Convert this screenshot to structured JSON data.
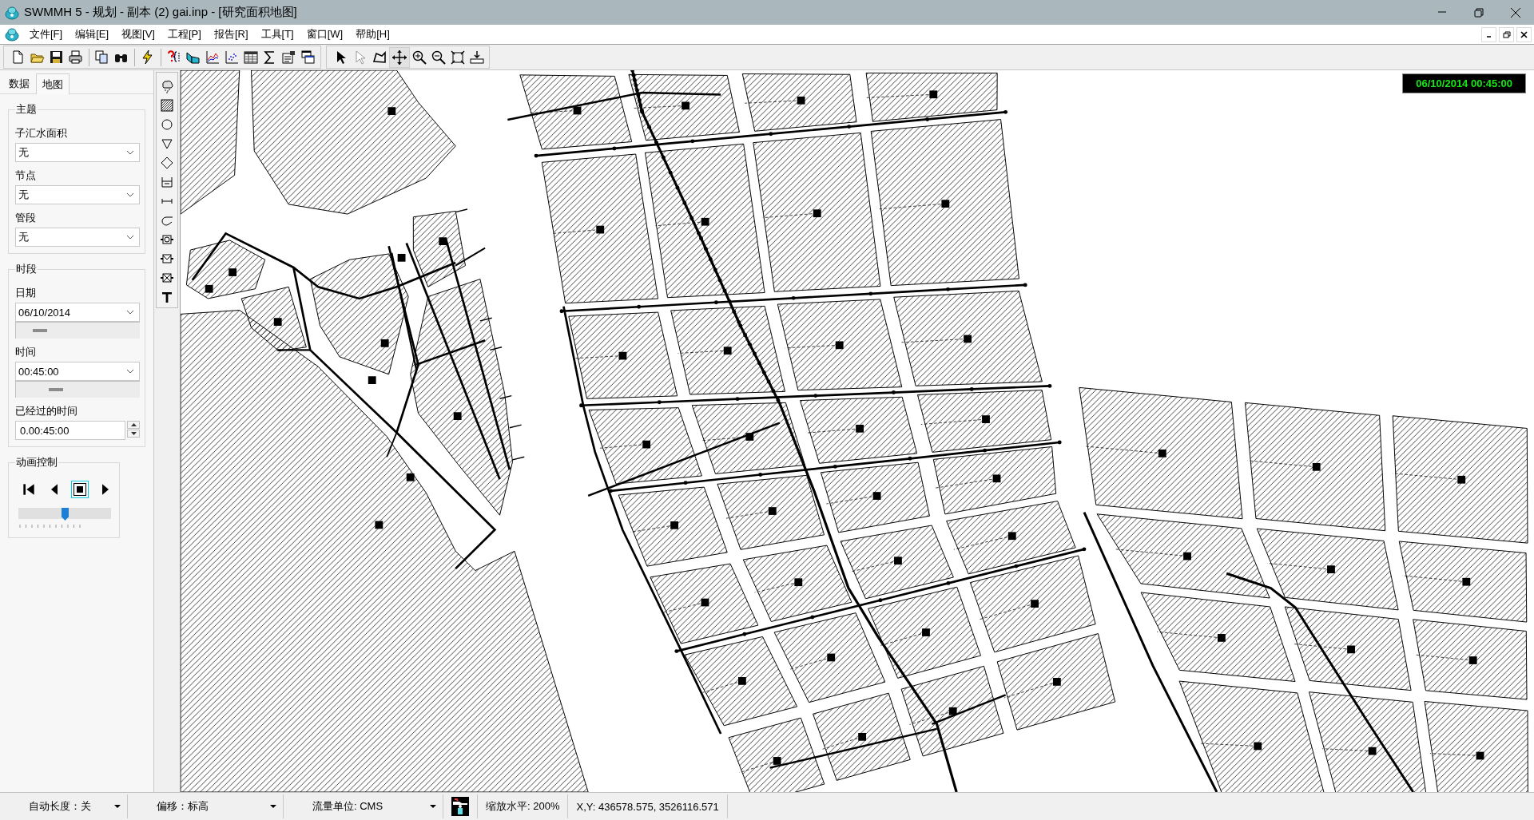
{
  "window": {
    "title": "SWMMH 5 - 规划 - 副本 (2) gai.inp - [研究面积地图]"
  },
  "menu": [
    "文件[F]",
    "编辑[E]",
    "视图[V]",
    "工程[P]",
    "报告[R]",
    "工具[T]",
    "窗口[W]",
    "帮助[H]"
  ],
  "side_panel": {
    "tabs": [
      {
        "label": "数据",
        "selected": false
      },
      {
        "label": "地图",
        "selected": true
      }
    ],
    "theme": {
      "title": "主题",
      "fields": [
        {
          "label": "子汇水面积",
          "value": "无"
        },
        {
          "label": "节点",
          "value": "无"
        },
        {
          "label": "管段",
          "value": "无"
        }
      ]
    },
    "period": {
      "title": "时段",
      "date": {
        "label": "日期",
        "value": "06/10/2014",
        "level": 0.15
      },
      "time": {
        "label": "时间",
        "value": "00:45:00",
        "level": 0.3
      },
      "elapsed": {
        "label": "已经过的时间",
        "value": "0.00:45:00"
      }
    },
    "animation": {
      "title": "动画控制",
      "buttons": [
        {
          "kind": "rewind",
          "selected": false
        },
        {
          "kind": "back",
          "selected": false
        },
        {
          "kind": "stop",
          "selected": true
        },
        {
          "kind": "forward",
          "selected": false
        }
      ],
      "level": 0.5
    }
  },
  "map": {
    "timestamp": "06/10/2014 00:45:00"
  },
  "status_bar": [
    {
      "kind": "dropdown",
      "text": "自动长度：关"
    },
    {
      "kind": "dropdown",
      "text": "偏移：标高"
    },
    {
      "kind": "dropdown",
      "text": "流量单位: CMS"
    },
    {
      "kind": "icon"
    },
    {
      "kind": "text",
      "text": "缩放水平: 200%"
    },
    {
      "kind": "text",
      "text": "X,Y: 436578.575, 3526116.571"
    }
  ]
}
